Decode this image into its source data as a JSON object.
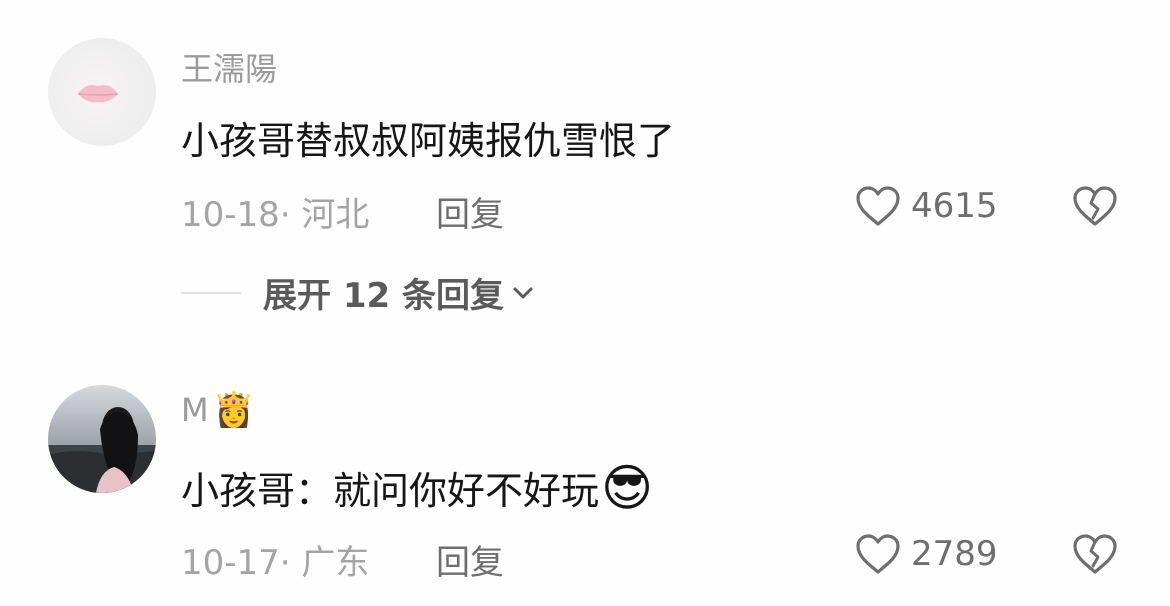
{
  "comments": [
    {
      "username": "王濡陽",
      "text": "小孩哥替叔叔阿姨报仇雪恨了",
      "date_location": "10-18· 河北",
      "reply_label": "回复",
      "likes": "4615",
      "replies_expand": "展开 12 条回复",
      "avatar_icon": "lips-icon",
      "like_icon": "heart-outline-icon",
      "dislike_icon": "broken-heart-icon"
    },
    {
      "username": "M",
      "username_emoji": "👸",
      "text": "小孩哥：就问你好不好玩",
      "text_emoji": "😎",
      "date_location": "10-17· 广东",
      "reply_label": "回复",
      "likes": "2789",
      "avatar_icon": "girl-photo-icon",
      "like_icon": "heart-outline-icon",
      "dislike_icon": "broken-heart-icon"
    }
  ],
  "colors": {
    "username": "#9b9b9b",
    "text": "#161616",
    "meta": "#a4a4a4",
    "action": "#6e6e6e"
  }
}
